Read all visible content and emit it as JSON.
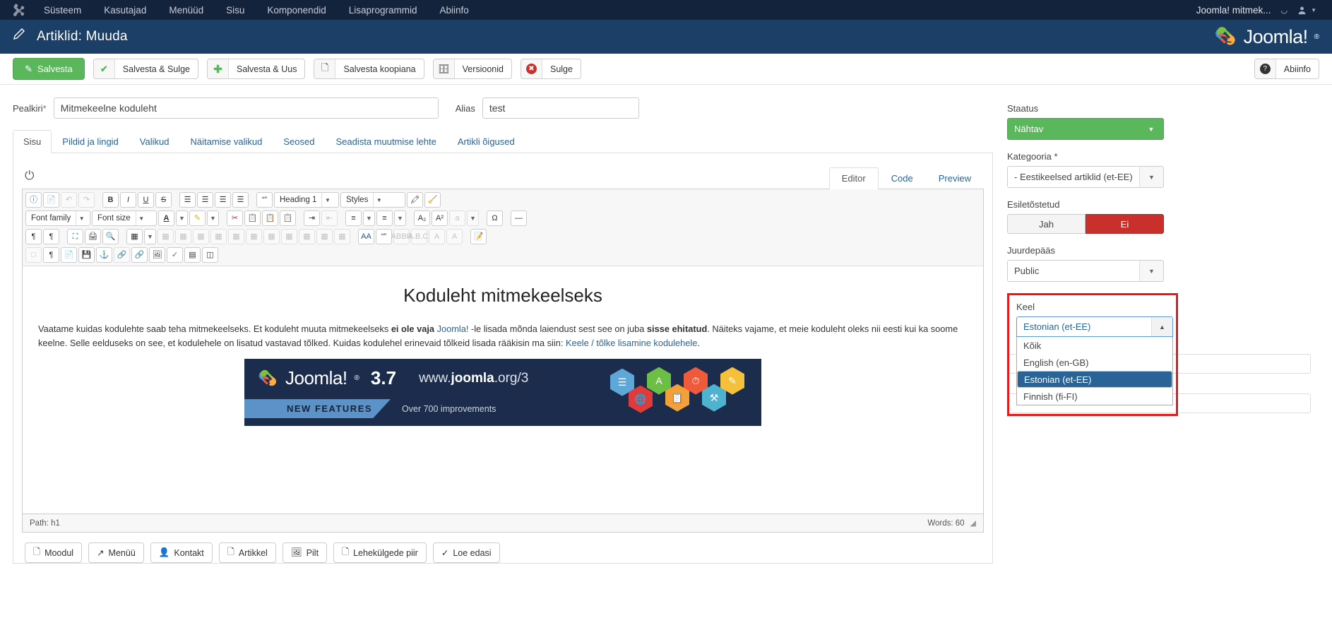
{
  "topbar": {
    "logo_icon": "joomla-icon",
    "menu": [
      "Süsteem",
      "Kasutajad",
      "Menüüd",
      "Sisu",
      "Komponendid",
      "Lisaprogrammid",
      "Abiinfo"
    ],
    "site_name": "Joomla! mitmek...",
    "external_icon": "external-link-icon",
    "user_icon": "user-icon",
    "caret_icon": "chevron-down-icon"
  },
  "header": {
    "icon": "pencil-icon",
    "title": "Artiklid: Muuda",
    "brand_text": "Joomla!",
    "brand_reg": "®"
  },
  "toolbar": {
    "save": "Salvesta",
    "save_close": "Salvesta & Sulge",
    "save_new": "Salvesta & Uus",
    "save_copy": "Salvesta koopiana",
    "versions": "Versioonid",
    "close": "Sulge",
    "help": "Abiinfo"
  },
  "form": {
    "title_label": "Pealkiri",
    "title_required": "*",
    "title_value": "Mitmekeelne koduleht",
    "title_placeholder": "",
    "alias_label": "Alias",
    "alias_value": "test",
    "alias_placeholder": ""
  },
  "tabs": [
    {
      "label": "Sisu",
      "active": true
    },
    {
      "label": "Pildid ja lingid",
      "active": false
    },
    {
      "label": "Valikud",
      "active": false
    },
    {
      "label": "Näitamise valikud",
      "active": false
    },
    {
      "label": "Seosed",
      "active": false
    },
    {
      "label": "Seadista muutmise lehte",
      "active": false
    },
    {
      "label": "Artikli õigused",
      "active": false
    }
  ],
  "editor": {
    "power_icon": "power-icon",
    "tabs": [
      {
        "label": "Editor",
        "active": true
      },
      {
        "label": "Code",
        "active": false
      },
      {
        "label": "Preview",
        "active": false
      }
    ],
    "format_select": "Heading 1",
    "styles_select": "Styles",
    "fontfamily_select": "Font family",
    "fontsize_select": "Font size",
    "content": {
      "heading": "Koduleht mitmekeelseks",
      "p1_a": "Vaatame kuidas kodulehte saab teha mitmekeelseks. Et koduleht muuta mitmekeelseks ",
      "p1_b": "ei ole vaja",
      "p1_c": " ",
      "p1_link": "Joomla!",
      "p1_d": " -le lisada mõnda laiendust sest see on juba ",
      "p1_e": "sisse ehitatud",
      "p1_f": ". Näiteks vajame, et meie koduleht oleks nii eesti kui ka soome keelne. Selle eelduseks on see, et kodulehele on lisatud vastavad tõlked. Kuidas kodulehel erinevaid tõlkeid lisada rääkisin ma siin: ",
      "p1_link2": "Keele / tõlke lisamine kodulehele",
      "p1_g": "."
    },
    "banner": {
      "brand": "Joomla!",
      "reg": "®",
      "version": "3.7",
      "url_pre": "www.",
      "url_mid": "joomla",
      "url_post": ".org/3",
      "new_features": "NEW FEATURES",
      "improvements": "Over 700 improvements"
    },
    "status_path_label": "Path:",
    "status_path_value": "h1",
    "status_words": "Words: 60",
    "resize_icon": "resize-handle-icon"
  },
  "footer_buttons": [
    {
      "label": "Moodul",
      "icon": "module-icon"
    },
    {
      "label": "Menüü",
      "icon": "menu-icon"
    },
    {
      "label": "Kontakt",
      "icon": "contact-icon"
    },
    {
      "label": "Artikkel",
      "icon": "article-icon"
    },
    {
      "label": "Pilt",
      "icon": "image-icon"
    },
    {
      "label": "Lehekülgede piir",
      "icon": "pagebreak-icon"
    },
    {
      "label": "Loe edasi",
      "icon": "readmore-icon"
    }
  ],
  "sidebar": {
    "status_label": "Staatus",
    "status_value": "Nähtav",
    "category_label": "Kategooria",
    "category_required": "*",
    "category_value": "- Eestikeelsed artiklid (et-EE)",
    "featured_label": "Esiletõstetud",
    "featured_yes": "Jah",
    "featured_no": "Ei",
    "access_label": "Juurdepääs",
    "access_value": "Public",
    "language_label": "Keel",
    "language_value": "Estonian (et-EE)",
    "language_options": [
      {
        "label": "Kõik",
        "selected": false
      },
      {
        "label": "English (en-GB)",
        "selected": false
      },
      {
        "label": "Estonian (et-EE)",
        "selected": true
      },
      {
        "label": "Finnish (fi-FI)",
        "selected": false
      }
    ]
  },
  "colors": {
    "topbar": "#13233c",
    "header": "#1c3f68",
    "green": "#5bb75b",
    "red": "#c9302c",
    "highlight_border": "#e8191b",
    "link": "#2a6496",
    "dropdown_selected": "#2a6496"
  }
}
